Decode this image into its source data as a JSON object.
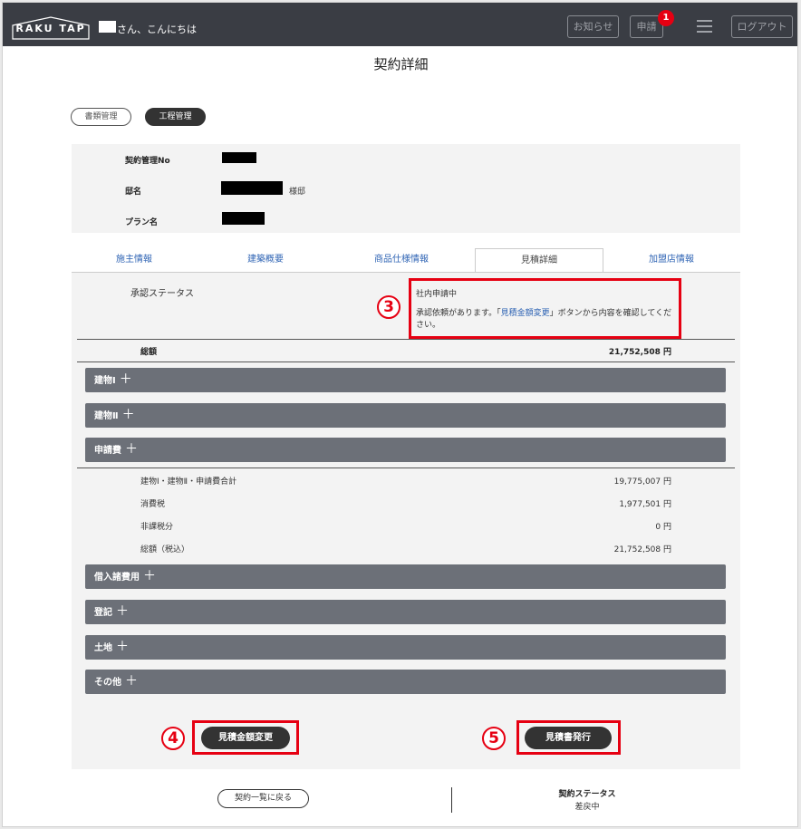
{
  "header": {
    "logo": "RAKU TAP",
    "greeting": "さん、こんにちは",
    "news_label": "お知らせ",
    "apply_label": "申請",
    "apply_badge": "1",
    "logout_label": "ログアウト"
  },
  "page_title": "契約詳細",
  "toggles": {
    "docs": "書類管理",
    "process": "工程管理"
  },
  "info": {
    "contract_no_label": "契約管理No",
    "residence_label": "邸名",
    "residence_suffix": "様邸",
    "plan_label": "プラン名"
  },
  "tabs": [
    "施主情報",
    "建築概要",
    "商品仕様情報",
    "見積詳細",
    "加盟店情報"
  ],
  "active_tab": "見積詳細",
  "status": {
    "label": "承認ステータス",
    "value": "社内申請中",
    "msg_before": "承認依頼があります。「",
    "msg_link": "見積金額変更",
    "msg_after": "」ボタンから内容を確認してください。"
  },
  "total": {
    "label": "総額",
    "value": "21,752,508 円"
  },
  "sections_top": [
    {
      "label": "建物Ⅰ"
    },
    {
      "label": "建物Ⅱ"
    },
    {
      "label": "申請費"
    }
  ],
  "subtotals": [
    {
      "label": "建物Ⅰ・建物Ⅱ・申請費合計",
      "value": "19,775,007 円"
    },
    {
      "label": "消費税",
      "value": "1,977,501 円"
    },
    {
      "label": "非課税分",
      "value": "0 円"
    },
    {
      "label": "総額（税込）",
      "value": "21,752,508 円"
    }
  ],
  "sections_bottom": [
    {
      "label": "借入諸費用"
    },
    {
      "label": "登記"
    },
    {
      "label": "土地"
    },
    {
      "label": "その他"
    }
  ],
  "annotations": {
    "n3": "3",
    "n4": "4",
    "n5": "5"
  },
  "actions": {
    "change_amount": "見積金額変更",
    "issue_estimate": "見積書発行"
  },
  "footer": {
    "back_label": "契約一覧に戻る",
    "contract_status_label": "契約ステータス",
    "contract_status_value": "差戻中"
  },
  "colors": {
    "header": "#3a3d44",
    "accent_red": "#e60012",
    "link_blue": "#2f64b4",
    "section_bar": "#6c7078"
  }
}
